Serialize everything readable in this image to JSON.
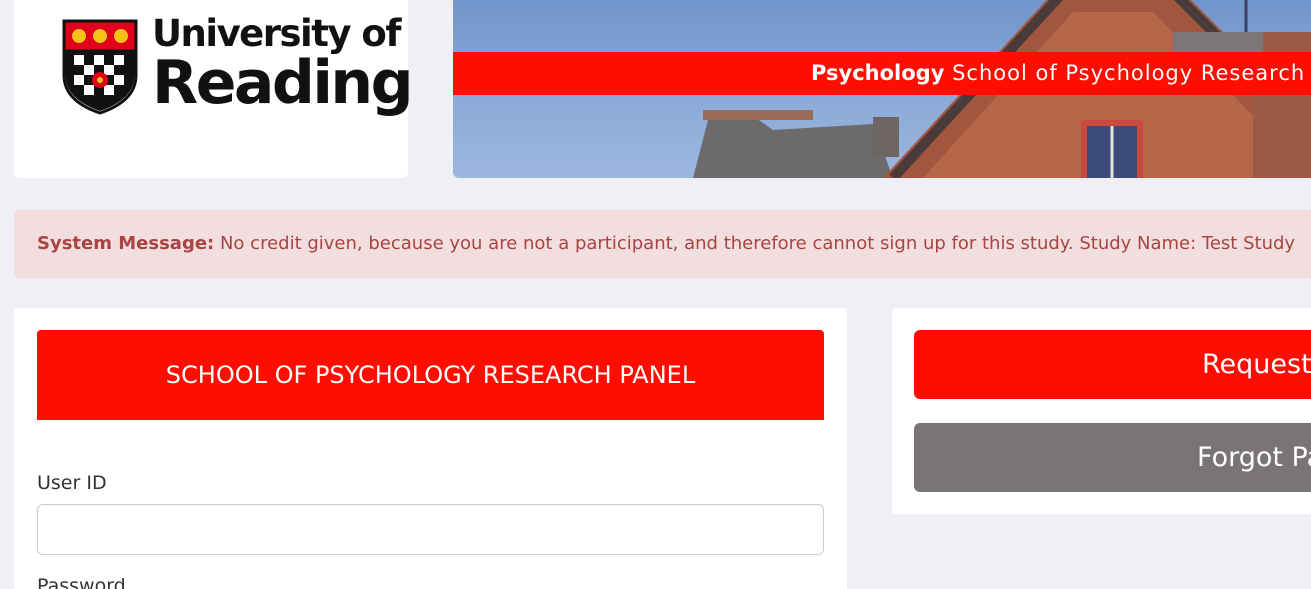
{
  "logo": {
    "line1": "University of",
    "line2": "Reading"
  },
  "banner": {
    "department": "Psychology",
    "tagline": "School of Psychology Research Panel"
  },
  "system_message": {
    "label": "System Message:",
    "text": "No credit given, because you are not a participant, and therefore cannot sign up for this study. Study Name: Test Study"
  },
  "login": {
    "heading": "SCHOOL OF PSYCHOLOGY RESEARCH PANEL",
    "user_id_label": "User ID",
    "user_id_value": "",
    "password_label": "Password"
  },
  "side": {
    "request_account_label": "Request Account",
    "forgot_password_label": "Forgot Password?"
  },
  "colors": {
    "brand_red": "#ff0d00",
    "message_bg": "#f2dede",
    "message_text": "#a94442",
    "secondary_button": "#7a7575",
    "page_bg": "#eef0f6"
  }
}
